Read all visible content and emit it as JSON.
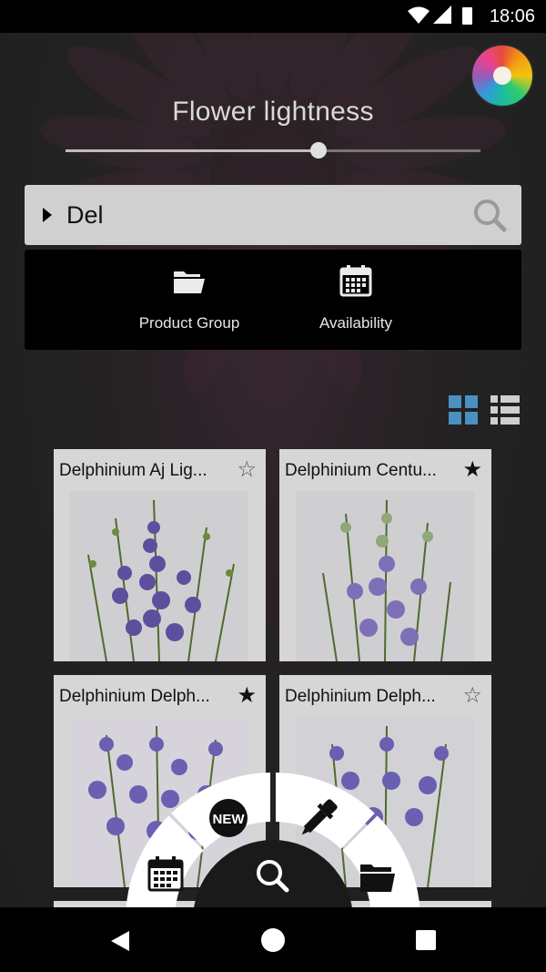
{
  "status_bar": {
    "time": "18:06"
  },
  "lightness": {
    "label": "Flower lightness",
    "value": 0.61
  },
  "search": {
    "query": "Del"
  },
  "filters": [
    {
      "label": "Product Group",
      "icon": "folder-icon"
    },
    {
      "label": "Availability",
      "icon": "calendar-icon"
    }
  ],
  "view_toggle": {
    "active": "grid",
    "grid_color": "#4a90c2",
    "list_color": "#cfcfcf"
  },
  "products": [
    {
      "name": "Delphinium Aj Lig...",
      "favorite": false
    },
    {
      "name": "Delphinium Centu...",
      "favorite": true
    },
    {
      "name": "Delphinium Delph...",
      "favorite": true
    },
    {
      "name": "Delphinium Delph...",
      "favorite": false
    }
  ],
  "radial_menu": {
    "items": [
      {
        "name": "calendar-icon"
      },
      {
        "name": "new-badge-icon",
        "label": "NEW"
      },
      {
        "name": "eyedropper-icon"
      },
      {
        "name": "folder-icon"
      }
    ],
    "center": "search-icon"
  },
  "icons": {
    "star_filled": "★",
    "star_empty": "☆"
  }
}
